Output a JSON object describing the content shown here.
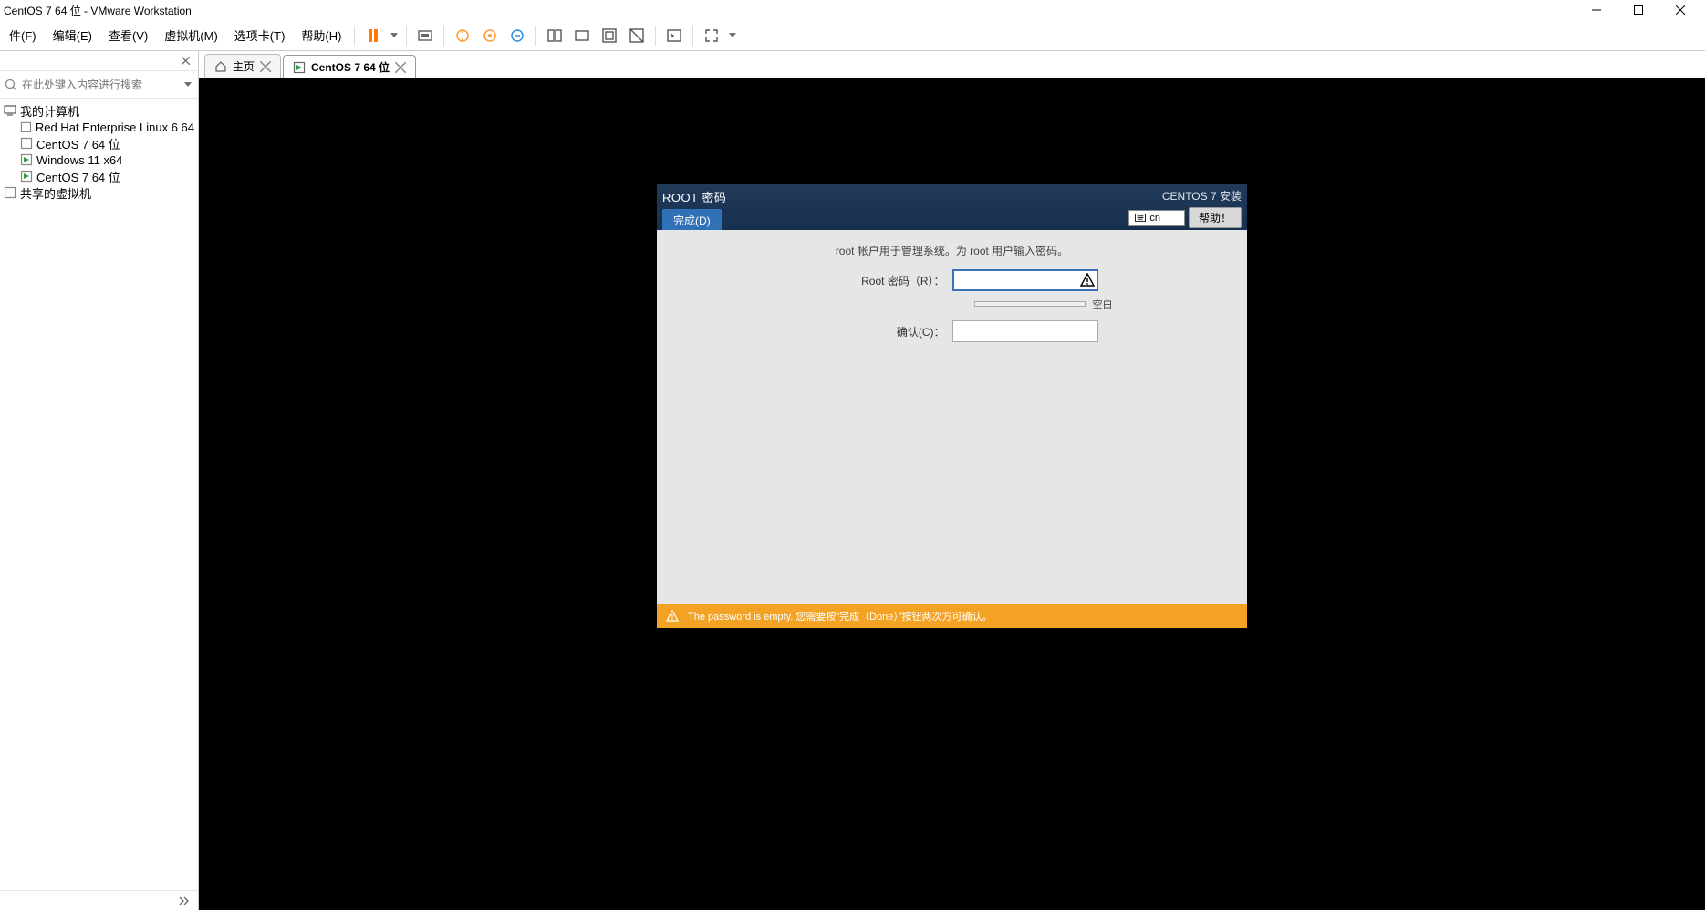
{
  "titlebar": {
    "text": "CentOS 7 64 位 - VMware Workstation"
  },
  "menu": {
    "file": "件(F)",
    "edit": "编辑(E)",
    "view": "查看(V)",
    "vm": "虚拟机(M)",
    "tabs": "选项卡(T)",
    "help": "帮助(H)"
  },
  "sidebar": {
    "search_placeholder": "在此处键入内容进行搜索",
    "root1": "我的计算机",
    "items": [
      {
        "label": "Red Hat Enterprise Linux 6 64"
      },
      {
        "label": "CentOS 7 64 位"
      },
      {
        "label": "Windows 11 x64"
      },
      {
        "label": "CentOS 7 64 位"
      }
    ],
    "root2": "共享的虚拟机"
  },
  "tabs": {
    "home": "主页",
    "active": "CentOS 7 64 位"
  },
  "guest": {
    "title": "ROOT 密码",
    "done_btn": "完成(D)",
    "install_label": "CENTOS 7 安装",
    "lang": "cn",
    "help_btn": "帮助！",
    "desc": "root 帐户用于管理系统。为 root 用户输入密码。",
    "pw_label": "Root 密码（R）：",
    "confirm_label": "确认(C)：",
    "strength_label": "空白",
    "footer_msg": "The password is empty. 您需要按“完成（Done）”按钮两次方可确认。"
  }
}
